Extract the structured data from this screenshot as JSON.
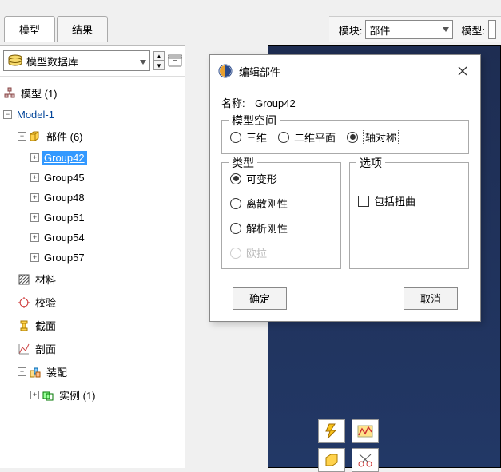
{
  "topbar": {
    "tabs": [
      {
        "label": "模型",
        "active": true
      },
      {
        "label": "结果",
        "active": false
      }
    ],
    "module_label": "模块:",
    "module_value": "部件",
    "model_label": "模型:"
  },
  "left_panel": {
    "db_label": "模型数据库",
    "tree": {
      "root": {
        "label": "模型 (1)"
      },
      "model": {
        "label": "Model-1"
      },
      "parts": {
        "label": "部件 (6)"
      },
      "groups": [
        "Group42",
        "Group45",
        "Group48",
        "Group51",
        "Group54",
        "Group57"
      ],
      "items": [
        {
          "label": "材料"
        },
        {
          "label": "校验"
        },
        {
          "label": "截面"
        },
        {
          "label": "剖面"
        },
        {
          "label": "装配"
        },
        {
          "label": "实例 (1)"
        }
      ]
    }
  },
  "dialog": {
    "title": "编辑部件",
    "name_label": "名称:",
    "name_value": "Group42",
    "fs_space": {
      "legend": "模型空间",
      "options": [
        {
          "label": "三维",
          "selected": false
        },
        {
          "label": "二维平面",
          "selected": false
        },
        {
          "label": "轴对称",
          "selected": true
        }
      ]
    },
    "fs_type": {
      "legend": "类型",
      "options": [
        {
          "label": "可变形",
          "selected": true,
          "disabled": false
        },
        {
          "label": "离散刚性",
          "selected": false,
          "disabled": false
        },
        {
          "label": "解析刚性",
          "selected": false,
          "disabled": false
        },
        {
          "label": "欧拉",
          "selected": false,
          "disabled": true
        }
      ]
    },
    "fs_options": {
      "legend": "选项",
      "checkbox_label": "包括扭曲"
    },
    "ok_label": "确定",
    "cancel_label": "取消"
  }
}
